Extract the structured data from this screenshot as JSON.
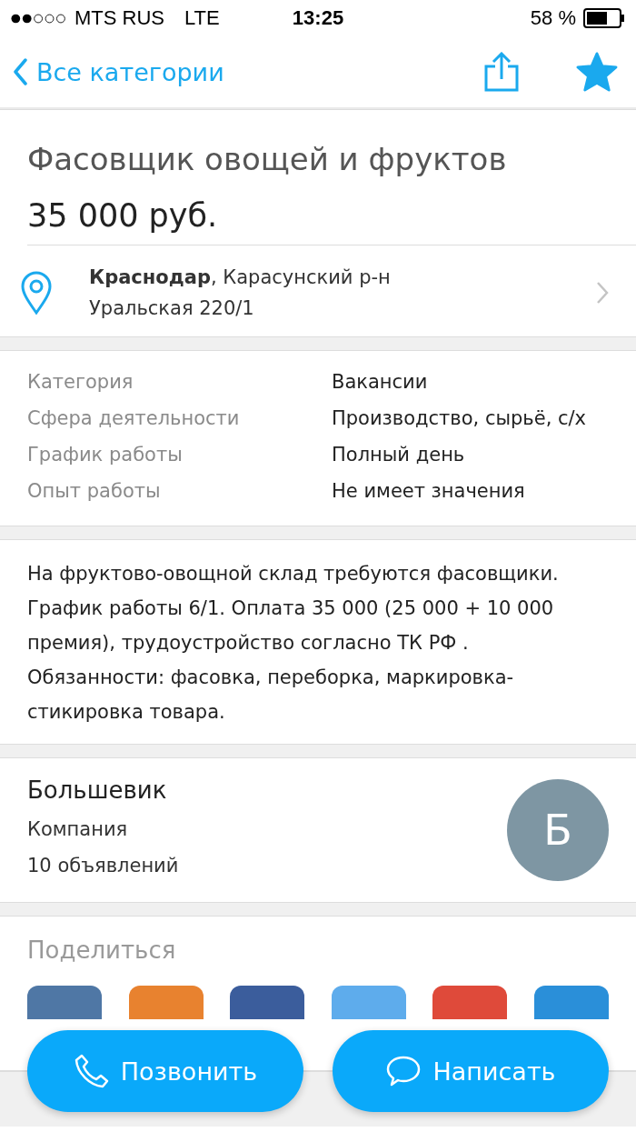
{
  "status_bar": {
    "carrier": "MTS RUS",
    "network": "LTE",
    "time": "13:25",
    "battery": "58 %"
  },
  "nav": {
    "back": "Все категории",
    "favorite": true
  },
  "listing": {
    "title": "Фасовщик овощей и фруктов",
    "price": "35 000 руб.",
    "address_line_1": "**Краснодар**, Карасунский р-н",
    "address_line_2": "Уральская 220/1"
  },
  "details": [
    {
      "label": "Категория",
      "value": "Вакансии"
    },
    {
      "label": "Сфера деятельности",
      "value": "Производство, сырьё, с/х"
    },
    {
      "label": "График работы",
      "value": "Полный день"
    },
    {
      "label": "Опыт работы",
      "value": "Не имеет значения"
    }
  ],
  "description": "На фруктово-овощной склад требуются фасовщики. График работы 6/1. Оплата 35 000 (25 000 + 10 000 премия), трудоустройство согласно ТК РФ . Обязанности: фасовка, переборка, маркировка-стикировка товара.",
  "seller": {
    "name": "Большевик",
    "type": "Компания",
    "ads": "10 объявлений",
    "avatar_letter": "Б"
  },
  "share": {
    "title": "Поделиться",
    "targets": [
      {
        "color": "#4f77a5"
      },
      {
        "color": "#e8822f"
      },
      {
        "color": "#3b5d9c"
      },
      {
        "color": "#5eacec"
      },
      {
        "color": "#df4a3a"
      },
      {
        "color": "#2a8fd9"
      }
    ]
  },
  "actions": [
    {
      "kind": "call",
      "label": "Позвонить"
    },
    {
      "kind": "message",
      "label": "Написать"
    }
  ]
}
